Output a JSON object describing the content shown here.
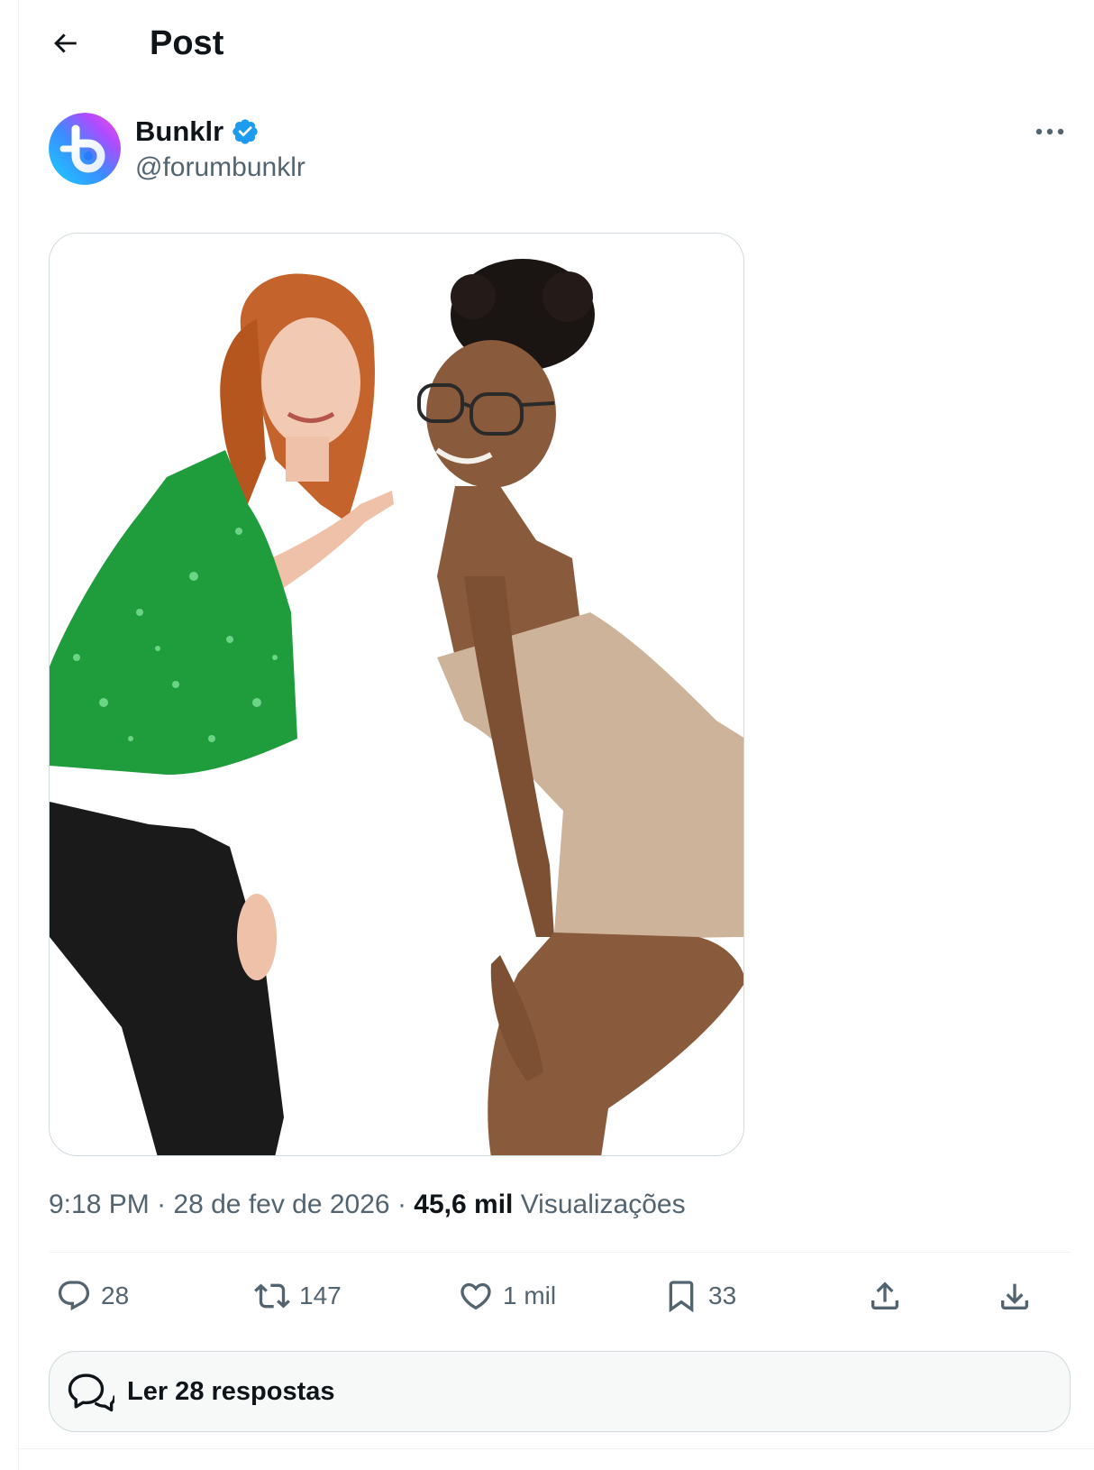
{
  "header": {
    "back_icon": "arrow-left-icon",
    "title": "Post"
  },
  "author": {
    "name": "Bunklr",
    "handle": "@forumbunklr",
    "verified_icon": "verified-badge-icon",
    "verified_color": "#1d9bf0",
    "avatar_icon": "bunklr-logo-icon",
    "more_icon": "more-horizontal-icon"
  },
  "media": {
    "alt": "Photo of two smiling women posing against a white background; one wears a green sequined top and black pants and points at the other, who wears glasses and a beige strapless mini dress."
  },
  "meta": {
    "time": "9:18 PM",
    "separator": " · ",
    "date": "28 de fev de 2026",
    "views_count": "45,6 mil",
    "views_label": "Visualizações"
  },
  "actions": {
    "reply": {
      "icon": "reply-icon",
      "count": "28"
    },
    "repost": {
      "icon": "repost-icon",
      "count": "147"
    },
    "like": {
      "icon": "heart-icon",
      "count": "1 mil"
    },
    "bookmark": {
      "icon": "bookmark-icon",
      "count": "33"
    },
    "share": {
      "icon": "share-icon"
    },
    "download": {
      "icon": "download-icon"
    }
  },
  "replies_button": {
    "icon": "chat-bubbles-icon",
    "label": "Ler 28 respostas"
  },
  "colors": {
    "text_primary": "#0f1419",
    "text_secondary": "#536471",
    "border": "#cfd9de",
    "accent": "#1d9bf0"
  }
}
